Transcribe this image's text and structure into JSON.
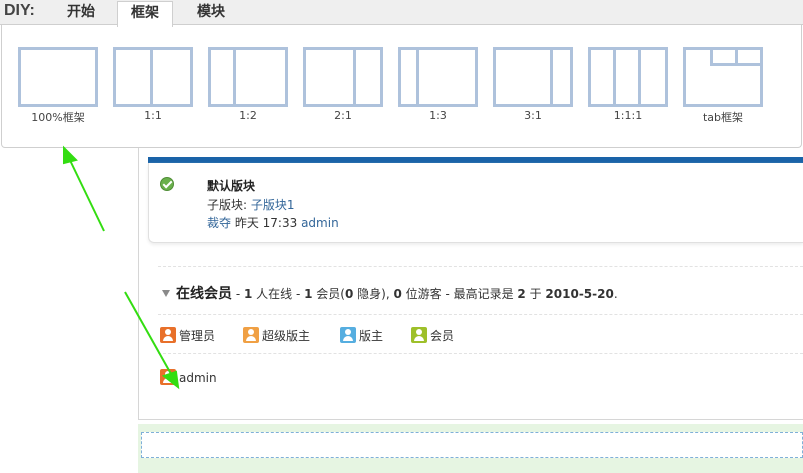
{
  "diy": {
    "label": "DIY:",
    "tabs": [
      {
        "label": "开始",
        "active": false
      },
      {
        "label": "框架",
        "active": true
      },
      {
        "label": "模块",
        "active": false
      }
    ]
  },
  "frames": [
    {
      "label": "100%框架",
      "layout": "100%"
    },
    {
      "label": "1:1",
      "layout": "1:1"
    },
    {
      "label": "1:2",
      "layout": "1:2"
    },
    {
      "label": "2:1",
      "layout": "2:1"
    },
    {
      "label": "1:3",
      "layout": "1:3"
    },
    {
      "label": "3:1",
      "layout": "3:1"
    },
    {
      "label": "1:1:1",
      "layout": "1:1:1"
    },
    {
      "label": "tab框架",
      "layout": "tab"
    }
  ],
  "block": {
    "title": "默认版块",
    "sub_label": "子版块:",
    "sub_link": "子版块1",
    "last_poster": "裁夺",
    "time": "昨天 17:33",
    "user": "admin"
  },
  "online": {
    "title": "在线会员",
    "sep1": " - ",
    "total": "1",
    "total_text": " 人在线 - ",
    "members": "1",
    "members_text": " 会员(",
    "hidden": "0",
    "hidden_text": " 隐身), ",
    "guests": "0",
    "guests_text": " 位游客 - 最高记录是 ",
    "record": "2",
    "record_text": " 于 ",
    "record_date": "2010-5-20",
    "end": "."
  },
  "legend": [
    {
      "label": "管理员",
      "icon": "admin-user-icon",
      "color": "#e8702a"
    },
    {
      "label": "超级版主",
      "icon": "super-moderator-icon",
      "color": "#f0a044"
    },
    {
      "label": "版主",
      "icon": "moderator-icon",
      "color": "#56aee0"
    },
    {
      "label": "会员",
      "icon": "member-icon",
      "color": "#9ec02a"
    }
  ],
  "online_users": [
    {
      "name": "admin",
      "icon": "admin-user-icon"
    }
  ],
  "colors": {
    "frame_border": "#aec2dc",
    "header_bar": "#1a63a8",
    "link": "#336699",
    "arrow": "#33dd11"
  }
}
